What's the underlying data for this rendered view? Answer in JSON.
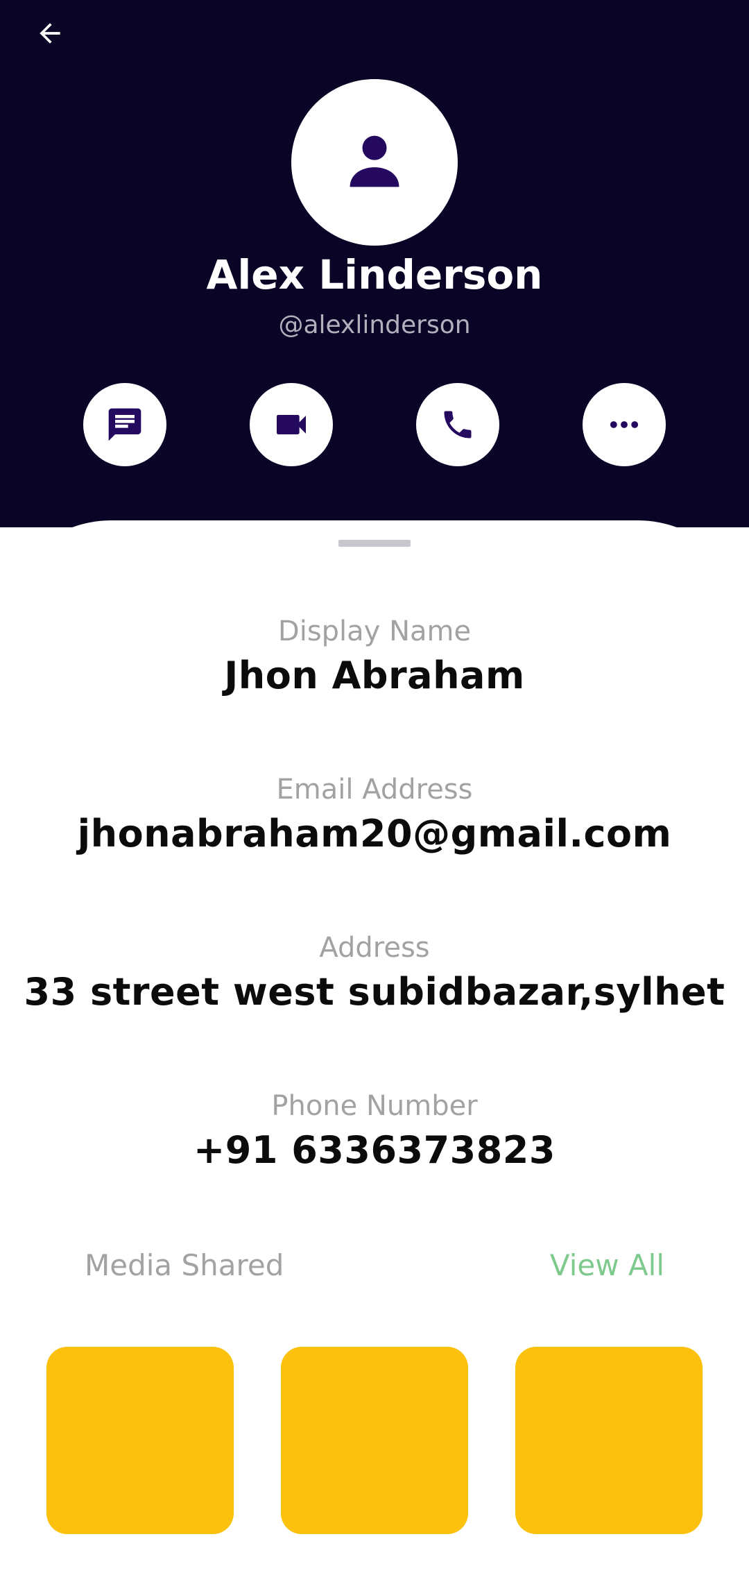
{
  "profile": {
    "name": "Alex Linderson",
    "handle": "@alexlinderson"
  },
  "actions": [
    {
      "name": "message",
      "icon": "message-icon"
    },
    {
      "name": "video-call",
      "icon": "video-camera-icon"
    },
    {
      "name": "voice-call",
      "icon": "phone-icon"
    },
    {
      "name": "more",
      "icon": "more-horizontal-icon"
    }
  ],
  "details": {
    "display_name": {
      "label": "Display Name",
      "value": "Jhon Abraham"
    },
    "email": {
      "label": "Email Address",
      "value": "jhonabraham20@gmail.com"
    },
    "address": {
      "label": "Address",
      "value": "33 street west subidbazar,sylhet"
    },
    "phone": {
      "label": "Phone Number",
      "value": "+91 6336373823"
    }
  },
  "media": {
    "label": "Media Shared",
    "view_all": "View All",
    "tile_color": "#fcc10d"
  },
  "colors": {
    "header_bg": "#0a0427",
    "icon_accent": "#24095e",
    "view_all": "#7ec98c"
  }
}
